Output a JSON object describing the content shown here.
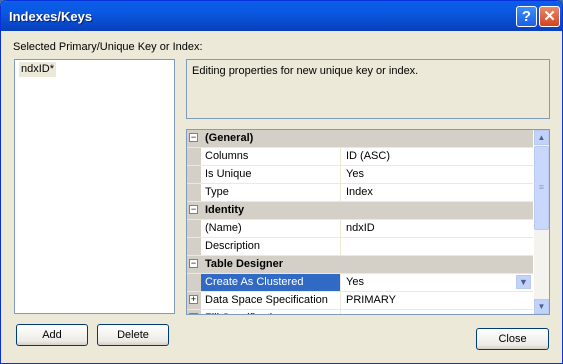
{
  "window": {
    "title": "Indexes/Keys"
  },
  "titlebar": {
    "help_glyph": "?",
    "close_glyph": "✕"
  },
  "list": {
    "label": "Selected Primary/Unique Key or Index:",
    "items": [
      "ndxID*"
    ]
  },
  "description": "Editing properties for new unique key or index.",
  "grid": {
    "categories": [
      {
        "name": "(General)",
        "rows": [
          {
            "name": "Columns",
            "value": "ID (ASC)"
          },
          {
            "name": "Is Unique",
            "value": "Yes"
          },
          {
            "name": "Type",
            "value": "Index"
          }
        ]
      },
      {
        "name": "Identity",
        "rows": [
          {
            "name": "(Name)",
            "value": "ndxID"
          },
          {
            "name": "Description",
            "value": ""
          }
        ]
      },
      {
        "name": "Table Designer",
        "rows": [
          {
            "name": "Create As Clustered",
            "value": "Yes",
            "selected": true
          },
          {
            "name": "Data Space Specification",
            "value": "PRIMARY",
            "expandable": true
          },
          {
            "name": "Fill Specification",
            "value": "",
            "expandable": true
          }
        ]
      }
    ]
  },
  "buttons": {
    "add": "Add",
    "delete": "Delete",
    "close": "Close"
  },
  "colors": {
    "titlebar": "#0a5ee8",
    "selection": "#316ac5",
    "dialog_bg": "#ece9d8"
  }
}
